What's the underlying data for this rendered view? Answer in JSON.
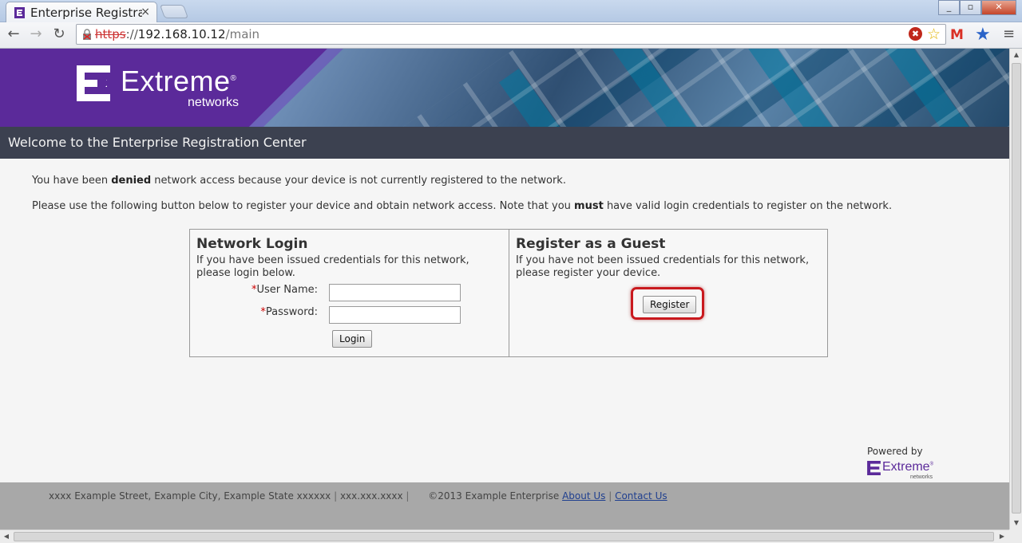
{
  "browser": {
    "tab_title": "Enterprise Registrat",
    "tab_close": "×",
    "url_proto": "https",
    "url_sep": "://",
    "url_host": "192.168.10.12",
    "url_path": "/main",
    "ext_stop_glyph": "✖",
    "bookmark_glyph": "☆",
    "gmail_glyph": "M",
    "bluestar_glyph": "★",
    "menu_glyph": "≡",
    "back_glyph": "←",
    "forward_glyph": "→",
    "reload_glyph": "↻",
    "minimize_glyph": "_",
    "maximize_glyph": "▫",
    "close_glyph": "✕"
  },
  "banner": {
    "brand": "Extreme",
    "reg_mark": "®",
    "sub": "networks"
  },
  "welcome": {
    "title": "Welcome to the Enterprise Registration Center"
  },
  "messages": {
    "line1_pre": "You have been ",
    "line1_bold": "denied",
    "line1_post": " network access because your device is not currently registered to the network.",
    "line2_pre": "Please use the following button below to register your device and obtain network access. Note that you ",
    "line2_bold": "must",
    "line2_post": " have valid login credentials to register on the network."
  },
  "login": {
    "heading": "Network Login",
    "description": "If you have been issued credentials for this network, please login below.",
    "required_mark": "*",
    "username_label": "User Name:",
    "username_value": "",
    "password_label": "Password:",
    "password_value": "",
    "button": "Login"
  },
  "guest": {
    "heading": "Register as a Guest",
    "description": "If you have not been issued credentials for this network, please register your device.",
    "button": "Register"
  },
  "powered": {
    "label": "Powered by",
    "brand": "Extreme",
    "reg_mark": "®",
    "sub": "networks"
  },
  "footer": {
    "address": "xxxx Example Street, Example City, Example State xxxxxx",
    "sep1": " | ",
    "phone": "xxx.xxx.xxxx",
    "sep2": " | ",
    "copyright": "©2013 Example Enterprise",
    "about": "About Us",
    "sep3": " | ",
    "contact": "Contact Us"
  },
  "scroll": {
    "up": "▲",
    "down": "▼",
    "left": "◀",
    "right": "▶"
  },
  "colors": {
    "brand_purple": "#5b2a9a",
    "header_bar": "#3c4150",
    "highlight_red": "#c9191e",
    "footer_bg": "#a8a8a8"
  }
}
